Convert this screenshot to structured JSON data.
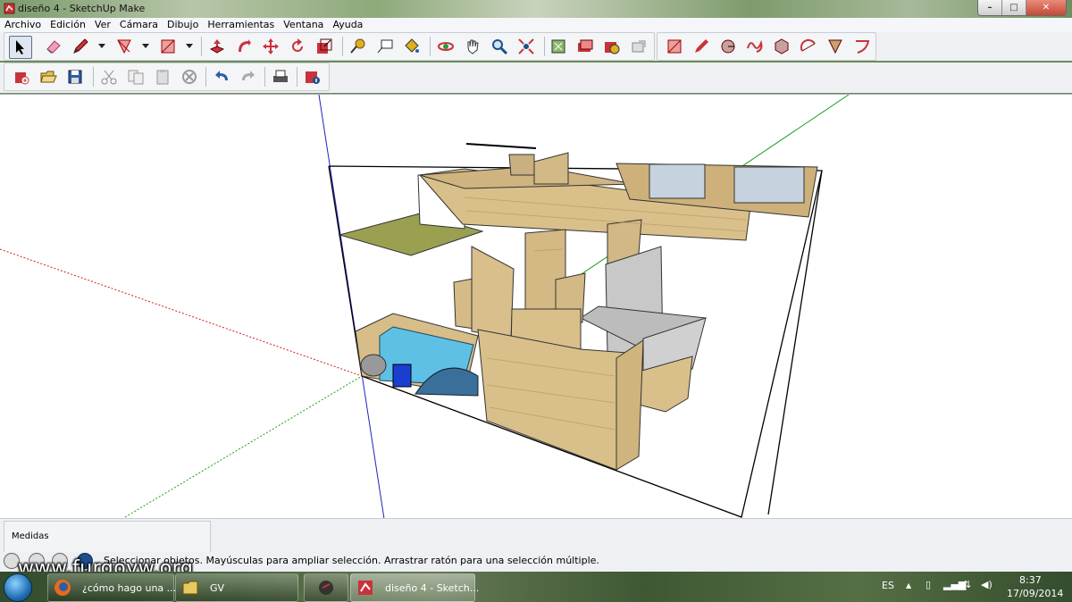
{
  "window": {
    "title": "diseño 4 - SketchUp Make",
    "min": "–",
    "max": "□",
    "close": "✕"
  },
  "menu": [
    "Archivo",
    "Edición",
    "Ver",
    "Cámara",
    "Dibujo",
    "Herramientas",
    "Ventana",
    "Ayuda"
  ],
  "measures": {
    "label": "Medidas"
  },
  "status": {
    "text": "Seleccionar objetos. Mayúsculas para ampliar selección. Arrastrar ratón para una selección múltiple."
  },
  "watermark": "www.furgovw.org",
  "taskbar": {
    "tasks": [
      "¿cómo hago una ...",
      "GV",
      "",
      "diseño 4 - Sketch..."
    ],
    "language": "ES",
    "time": "8:37",
    "date": "17/09/2014"
  },
  "colors": {
    "accent": "#c8333a",
    "wood": "#d9c08a",
    "water": "#5ec0e4",
    "glass": "#c6d3df",
    "axis_red": "#d02020",
    "axis_green": "#1aa11a",
    "axis_blue": "#2020c0"
  },
  "icons": [
    "select-icon",
    "eraser-icon",
    "pencil-icon",
    "rectangle-icon",
    "pushpull-icon",
    "move-icon",
    "rotate-icon",
    "scale-icon",
    "orbit-icon",
    "pan-icon",
    "zoom-icon",
    "zoom-extents-icon",
    "new-icon",
    "open-icon",
    "save-icon",
    "cut-icon",
    "copy-icon",
    "paste-icon",
    "delete-icon",
    "undo-icon",
    "redo-icon",
    "print-icon",
    "model-info-icon"
  ]
}
